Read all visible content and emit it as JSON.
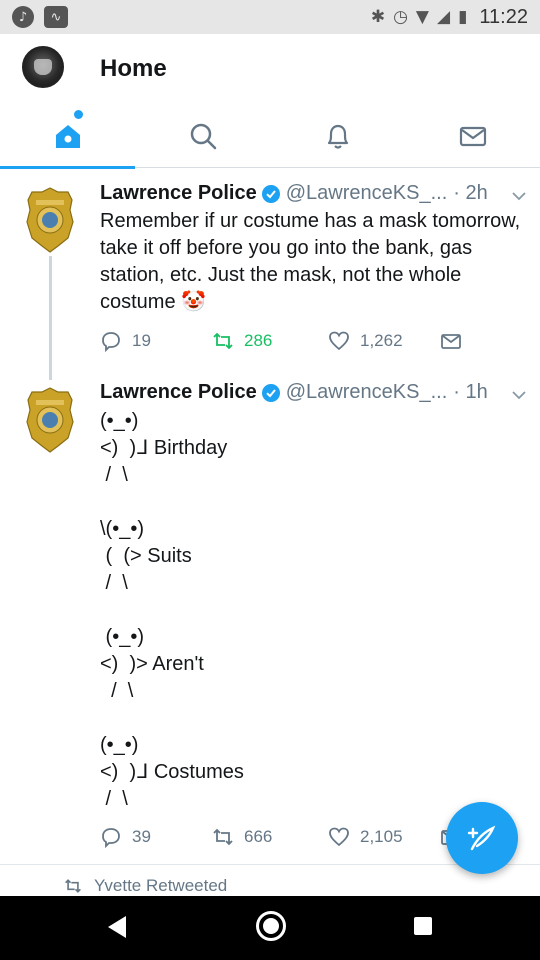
{
  "status_bar": {
    "time": "11:22",
    "left_icons": [
      "music-note-icon",
      "activity-icon"
    ],
    "right_icons": [
      "bluetooth-icon",
      "alarm-icon",
      "wifi-icon",
      "signal-icon",
      "battery-icon"
    ]
  },
  "header": {
    "title": "Home"
  },
  "tabs": [
    {
      "name": "home-icon",
      "active": true,
      "has_dot": true
    },
    {
      "name": "search-icon",
      "active": false
    },
    {
      "name": "bell-icon",
      "active": false
    },
    {
      "name": "mail-icon",
      "active": false
    }
  ],
  "tweets": [
    {
      "name": "Lawrence Police",
      "handle": "@LawrenceKS_...",
      "time": "· 2h",
      "text": "Remember if ur costume has a mask tomorrow, take it off before you go into the bank, gas station, etc. Just the mask, not the whole costume",
      "emoji": "🤡",
      "replies": "19",
      "retweets": "286",
      "likes": "1,262"
    },
    {
      "name": "Lawrence Police",
      "handle": "@LawrenceKS_...",
      "time": "· 1h",
      "ascii_lines": [
        "(•_•)",
        "<)  )ᒧ Birthday",
        " /  \\",
        "",
        "\\(•_•)",
        " (  (> Suits",
        " /  \\",
        "",
        " (•_•)",
        "<)  )> Aren't",
        "  /  \\",
        "",
        "(•_•)",
        "<)  )ᒧ Costumes",
        " /  \\"
      ],
      "replies": "39",
      "retweets": "666",
      "likes": "2,105"
    }
  ],
  "retweeted_label": "Yvette Retweeted",
  "colors": {
    "accent": "#1da1f2",
    "retweet_green": "#17bf63",
    "muted": "#657786"
  }
}
